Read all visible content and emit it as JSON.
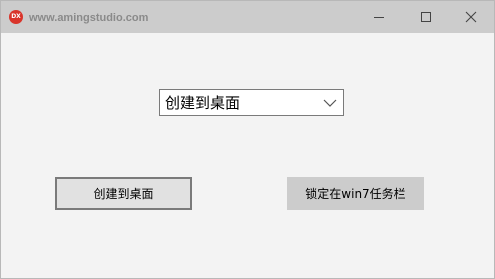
{
  "window": {
    "title": "www.amingstudio.com",
    "app_icon_text": "DX",
    "controls": {
      "minimize_icon": "minimize-icon",
      "maximize_icon": "maximize-icon",
      "close_icon": "close-icon"
    }
  },
  "combo": {
    "selected": "创建到桌面",
    "arrow_icon": "chevron-down-icon"
  },
  "buttons": {
    "create_desktop": "创建到桌面",
    "pin_taskbar": "锁定在win7任务栏"
  },
  "colors": {
    "titlebar": "#cccccc",
    "window_bg": "#f3f3f3",
    "app_icon": "#d9352b"
  }
}
